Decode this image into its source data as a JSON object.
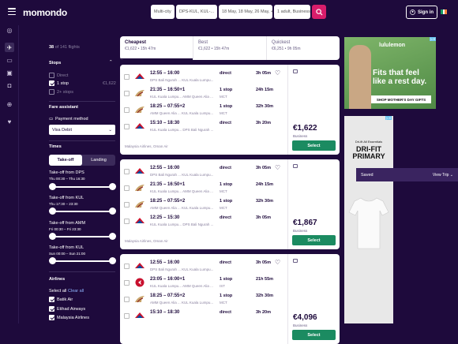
{
  "header": {
    "logo_main": "momondo",
    "trip_type": "Multi-city",
    "route": "DPS-KUL, KUL-...",
    "dates": "18 May, 18 May, 26 May, +1",
    "travellers": "1 adult, Business",
    "signin_label": "Sign in"
  },
  "filters": {
    "result_count": "38",
    "result_suffix": "of 141 flights",
    "stops_title": "Stops",
    "stops": [
      {
        "label": "Direct",
        "price": "",
        "checked": false
      },
      {
        "label": "1 stop",
        "price": "€1,622",
        "checked": true
      },
      {
        "label": "2+ stops",
        "price": "",
        "checked": false
      }
    ],
    "fare_title": "Fare assistant",
    "payment_label": "Payment method",
    "payment_value": "Visa Debit",
    "times_title": "Times",
    "times_tabs": [
      "Take-off",
      "Landing"
    ],
    "sliders": [
      {
        "label": "Take-off from DPS",
        "range": "Thu 00:30 – Thu 16:30",
        "low": 0.0,
        "high": 1.0
      },
      {
        "label": "Take-off from KUL",
        "range": "Thu 17:30 – 23:30",
        "low": 0.0,
        "high": 1.0
      },
      {
        "label": "Take-off from AMM",
        "range": "Fri 00:30 – Fri 23:30",
        "low": 0.0,
        "high": 1.0
      },
      {
        "label": "Take-off from KUL",
        "range": "Sun 00:00 – Sun 21:00",
        "low": 0.0,
        "high": 1.0
      }
    ],
    "airlines_title": "Airlines",
    "select_all": "Select all",
    "clear_all": "Clear all",
    "airlines": [
      "Batik Air",
      "Etihad Airways",
      "Malaysia Airlines"
    ]
  },
  "tabs": [
    {
      "label": "Cheapest",
      "sub": "€1,622 • 15h 47m"
    },
    {
      "label": "Best",
      "sub": "€1,622 • 15h 47m"
    },
    {
      "label": "Quickest",
      "sub": "€6,251 • 9h 05m"
    }
  ],
  "results": [
    {
      "price": "€1,622",
      "class": "Business",
      "select_label": "Select",
      "operator": "Malaysia Airlines, Oman Air",
      "legs": [
        {
          "time": "12:55 – 16:00",
          "route": "DPS Bali Ngurah ... KUL Kuala Lumpu...",
          "stops": "direct",
          "via": "",
          "duration": "3h 05m",
          "airline": "mh"
        },
        {
          "time": "21:35 – 16:50+1",
          "route": "KUL Kuala Lumpu... AMM Queen Alia ...",
          "stops": "1 stop",
          "via": "MCT",
          "duration": "24h 15m",
          "airline": "wy"
        },
        {
          "time": "18:25 – 07:55+2",
          "route": "AMM Queen Alia ... KUL Kuala Lumpu...",
          "stops": "1 stop",
          "via": "MCT",
          "duration": "32h 30m",
          "airline": "wy"
        },
        {
          "time": "15:10 – 18:30",
          "route": "KUL Kuala Lumpu... DPS Bali Ngurah ...",
          "stops": "direct",
          "via": "",
          "duration": "3h 20m",
          "airline": "mh"
        }
      ]
    },
    {
      "price": "€1,867",
      "class": "Business",
      "select_label": "Select",
      "operator": "Malaysia Airlines, Oman Air",
      "legs": [
        {
          "time": "12:55 – 16:00",
          "route": "DPS Bali Ngurah ... KUL Kuala Lumpu...",
          "stops": "direct",
          "via": "",
          "duration": "3h 05m",
          "airline": "mh"
        },
        {
          "time": "21:35 – 16:50+1",
          "route": "KUL Kuala Lumpu... AMM Queen Alia ...",
          "stops": "1 stop",
          "via": "MCT",
          "duration": "24h 15m",
          "airline": "wy"
        },
        {
          "time": "18:25 – 07:55+2",
          "route": "AMM Queen Alia ... KUL Kuala Lumpu...",
          "stops": "1 stop",
          "via": "MCT",
          "duration": "32h 30m",
          "airline": "wy"
        },
        {
          "time": "12:25 – 15:30",
          "route": "KUL Kuala Lumpu... DPS Bali Ngurah ...",
          "stops": "direct",
          "via": "",
          "duration": "3h 05m",
          "airline": "mh"
        }
      ]
    },
    {
      "price": "€4,096",
      "class": "Business",
      "select_label": "Select",
      "operator": "",
      "legs": [
        {
          "time": "12:55 – 16:00",
          "route": "DPS Bali Ngurah ... KUL Kuala Lumpu...",
          "stops": "direct",
          "via": "",
          "duration": "3h 05m",
          "airline": "mh"
        },
        {
          "time": "23:05 – 16:00+1",
          "route": "KUL Kuala Lumpu... AMM Queen Alia ...",
          "stops": "1 stop",
          "via": "IST",
          "duration": "21h 55m",
          "airline": "tk"
        },
        {
          "time": "18:25 – 07:55+2",
          "route": "AMM Queen Alia ... KUL Kuala Lumpu...",
          "stops": "1 stop",
          "via": "MCT",
          "duration": "32h 30m",
          "airline": "wy"
        },
        {
          "time": "15:10 – 18:30",
          "route": "",
          "stops": "direct",
          "via": "",
          "duration": "3h 20m",
          "airline": "mh"
        }
      ]
    }
  ],
  "ads": {
    "ad1_brand": "lululemon",
    "ad1_headline": "Fits that feel like a rest day.",
    "ad1_cta": "SHOP MOTHER'S DAY GIFTS",
    "ad2_brand": "Dri-fit All Essentials",
    "ad2_headline": "DRI-FIT PRIMARY"
  },
  "saved_bar": {
    "label": "Saved",
    "action": "View Trip"
  },
  "colors": {
    "bg": "#1e0a3c",
    "accent": "#d91d6b",
    "select": "#1b8b61"
  }
}
